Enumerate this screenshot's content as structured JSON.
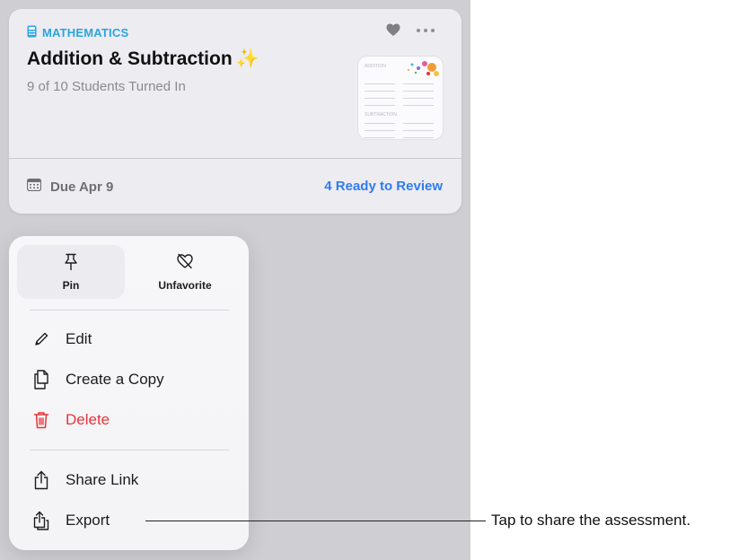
{
  "card": {
    "subject": "MATHEMATICS",
    "title": "Addition & Subtraction",
    "title_emoji": "✨",
    "subtitle": "9 of 10 Students Turned In",
    "due": "Due Apr 9",
    "review": "4 Ready to Review",
    "thumbnail": {
      "section_1": "ADDITION",
      "section_2": "SUBTRACTION"
    }
  },
  "menu": {
    "top_actions": [
      {
        "label": "Pin",
        "icon": "pin-icon"
      },
      {
        "label": "Unfavorite",
        "icon": "heart-slash-icon"
      }
    ],
    "items": [
      {
        "label": "Edit",
        "icon": "pencil-icon"
      },
      {
        "label": "Create a Copy",
        "icon": "copy-icon"
      },
      {
        "label": "Delete",
        "icon": "trash-icon",
        "color": "#e8343a"
      },
      {
        "label": "Share Link",
        "icon": "share-icon"
      },
      {
        "label": "Export",
        "icon": "export-icon"
      }
    ]
  },
  "callout": {
    "text": "Tap to share the assessment."
  },
  "colors": {
    "accent_blue": "#2f7bf5",
    "subject_blue": "#2aa4e0",
    "destructive_red": "#e8343a"
  }
}
